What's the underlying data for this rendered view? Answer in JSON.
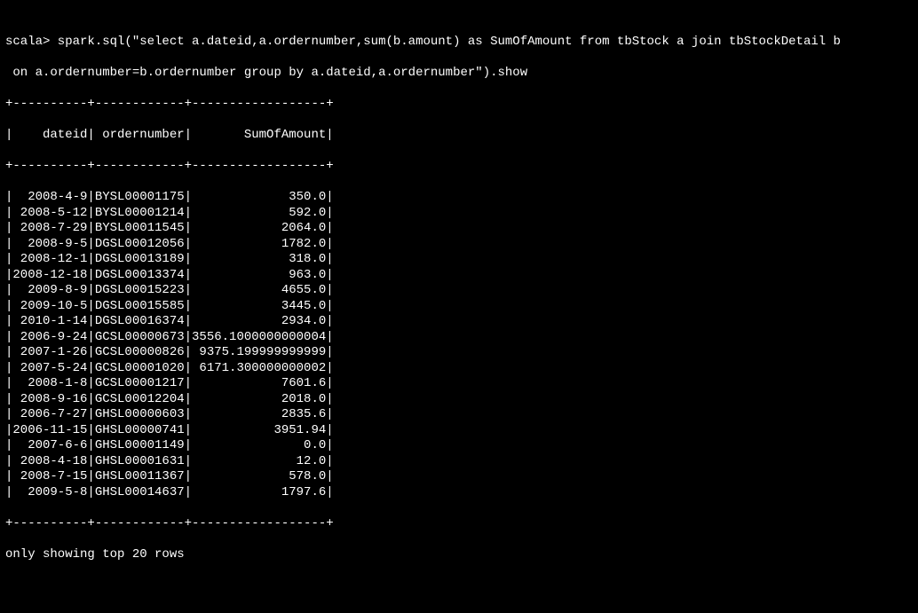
{
  "prompt": {
    "line1": "scala> spark.sql(\"select a.dateid,a.ordernumber,sum(b.amount) as SumOfAmount from tbStock a join tbStockDetail b",
    "line2": " on a.ordernumber=b.ordernumber group by a.dateid,a.ordernumber\").show"
  },
  "chart_data": {
    "type": "table",
    "columns": [
      "dateid",
      "ordernumber",
      "SumOfAmount"
    ],
    "widths": [
      10,
      12,
      18
    ],
    "rows": [
      {
        "dateid": "2008-4-9",
        "ordernumber": "BYSL00001175",
        "SumOfAmount": "350.0"
      },
      {
        "dateid": "2008-5-12",
        "ordernumber": "BYSL00001214",
        "SumOfAmount": "592.0"
      },
      {
        "dateid": "2008-7-29",
        "ordernumber": "BYSL00011545",
        "SumOfAmount": "2064.0"
      },
      {
        "dateid": "2008-9-5",
        "ordernumber": "DGSL00012056",
        "SumOfAmount": "1782.0"
      },
      {
        "dateid": "2008-12-1",
        "ordernumber": "DGSL00013189",
        "SumOfAmount": "318.0"
      },
      {
        "dateid": "2008-12-18",
        "ordernumber": "DGSL00013374",
        "SumOfAmount": "963.0"
      },
      {
        "dateid": "2009-8-9",
        "ordernumber": "DGSL00015223",
        "SumOfAmount": "4655.0"
      },
      {
        "dateid": "2009-10-5",
        "ordernumber": "DGSL00015585",
        "SumOfAmount": "3445.0"
      },
      {
        "dateid": "2010-1-14",
        "ordernumber": "DGSL00016374",
        "SumOfAmount": "2934.0"
      },
      {
        "dateid": "2006-9-24",
        "ordernumber": "GCSL00000673",
        "SumOfAmount": "3556.1000000000004"
      },
      {
        "dateid": "2007-1-26",
        "ordernumber": "GCSL00000826",
        "SumOfAmount": " 9375.199999999999"
      },
      {
        "dateid": "2007-5-24",
        "ordernumber": "GCSL00001020",
        "SumOfAmount": " 6171.300000000002"
      },
      {
        "dateid": "2008-1-8",
        "ordernumber": "GCSL00001217",
        "SumOfAmount": "7601.6"
      },
      {
        "dateid": "2008-9-16",
        "ordernumber": "GCSL00012204",
        "SumOfAmount": "2018.0"
      },
      {
        "dateid": "2006-7-27",
        "ordernumber": "GHSL00000603",
        "SumOfAmount": "2835.6"
      },
      {
        "dateid": "2006-11-15",
        "ordernumber": "GHSL00000741",
        "SumOfAmount": "3951.94"
      },
      {
        "dateid": "2007-6-6",
        "ordernumber": "GHSL00001149",
        "SumOfAmount": "0.0"
      },
      {
        "dateid": "2008-4-18",
        "ordernumber": "GHSL00001631",
        "SumOfAmount": "12.0"
      },
      {
        "dateid": "2008-7-15",
        "ordernumber": "GHSL00011367",
        "SumOfAmount": "578.0"
      },
      {
        "dateid": "2009-5-8",
        "ordernumber": "GHSL00014637",
        "SumOfAmount": "1797.6"
      }
    ]
  },
  "footer": "only showing top 20 rows"
}
